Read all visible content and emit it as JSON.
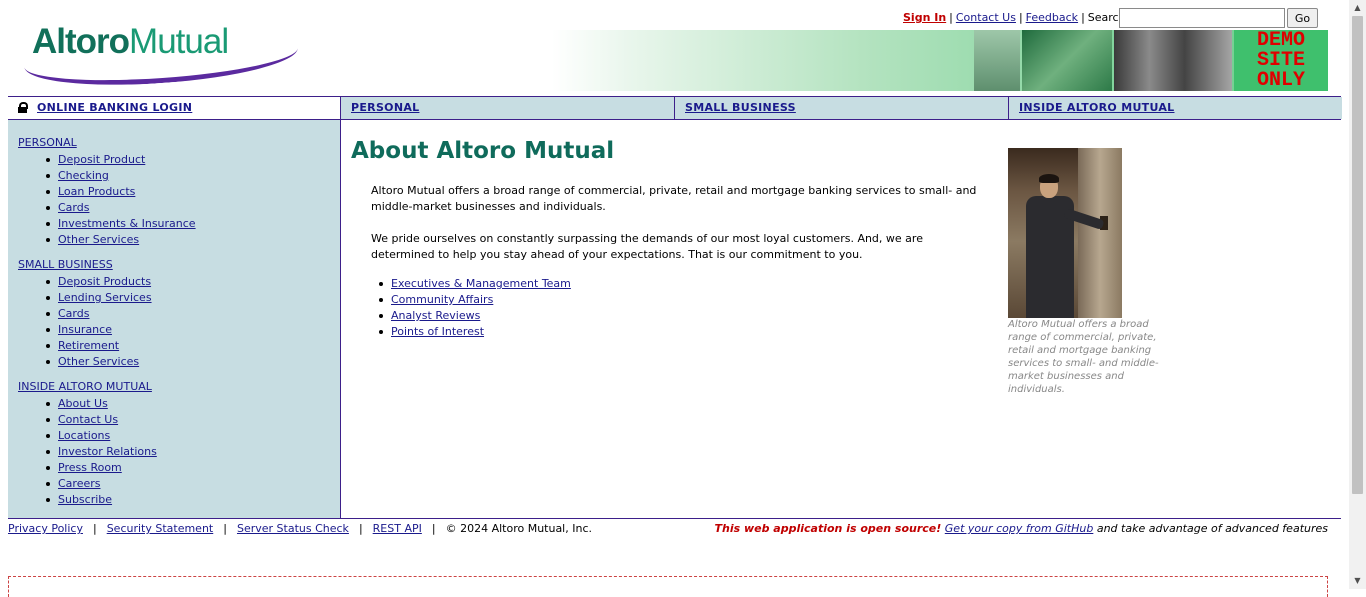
{
  "header": {
    "logo_part1": "Altoro",
    "logo_part2": "Mutual",
    "links": {
      "sign_in": "Sign In",
      "contact_us": "Contact Us",
      "feedback": "Feedback"
    },
    "search_label": "Search",
    "search_value": "",
    "go_label": "Go",
    "demo_line1": "DEMO",
    "demo_line2": "SITE",
    "demo_line3": "ONLY"
  },
  "nav": {
    "login": "ONLINE BANKING LOGIN",
    "personal": "PERSONAL",
    "small_business": "SMALL BUSINESS",
    "inside": "INSIDE ALTORO MUTUAL"
  },
  "sidebar": {
    "personal": {
      "title": "PERSONAL",
      "items": [
        "Deposit Product",
        "Checking",
        "Loan Products",
        "Cards",
        "Investments & Insurance",
        "Other Services"
      ]
    },
    "small_business": {
      "title": "SMALL BUSINESS",
      "items": [
        "Deposit Products",
        "Lending Services",
        "Cards",
        "Insurance",
        "Retirement",
        "Other Services"
      ]
    },
    "inside": {
      "title": "INSIDE ALTORO MUTUAL",
      "items": [
        "About Us",
        "Contact Us",
        "Locations",
        "Investor Relations",
        "Press Room",
        "Careers",
        "Subscribe"
      ]
    }
  },
  "main": {
    "title": "About Altoro Mutual",
    "para1": "Altoro Mutual offers a broad range of commercial, private, retail and mortgage banking services to small- and middle-market businesses and individuals.",
    "para2": "We pride ourselves on constantly surpassing the demands of our most loyal customers. And, we are determined to help you stay ahead of your expectations. That is our commitment to you.",
    "links": [
      "Executives & Management Team",
      "Community Affairs",
      "Analyst Reviews",
      "Points of Interest"
    ],
    "caption": "Altoro Mutual offers a broad range of commercial, private, retail and mortgage banking services to small- and middle-market businesses and individuals."
  },
  "footer": {
    "privacy": "Privacy Policy",
    "security": "Security Statement",
    "server_status": "Server Status Check",
    "rest_api": "REST API",
    "copyright": "© 2024 Altoro Mutual, Inc.",
    "open_source": "This web application is open source!",
    "github": "Get your copy from GitHub",
    "tail": "and take advantage of advanced features"
  },
  "colors": {
    "nav_bg": "#c7dde2",
    "title_green": "#0f6b5b",
    "border_purple": "#3d1f8a",
    "alert_red": "#c00000"
  }
}
